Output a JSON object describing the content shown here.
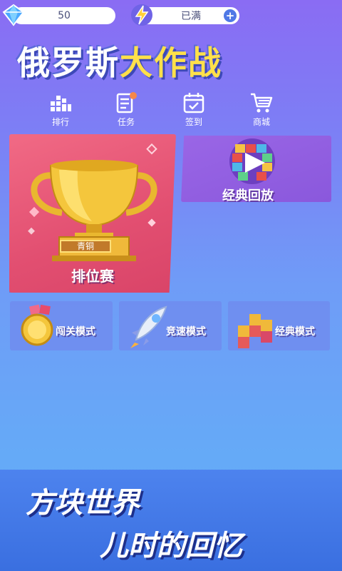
{
  "resources": {
    "gems": "50",
    "energy": "已满",
    "plus": "+"
  },
  "title": {
    "part1": "俄罗斯",
    "part2": "大作战"
  },
  "nav": {
    "rank": "排行",
    "tasks": "任务",
    "signin": "签到",
    "shop": "商城"
  },
  "cards": {
    "ranked": "排位赛",
    "tier": "青铜",
    "replay": "经典回放"
  },
  "modes": {
    "level": "闯关模式",
    "speed": "竞速模式",
    "classic": "经典模式"
  },
  "banner": {
    "line1": "方块世界",
    "line2": "儿时的回忆"
  },
  "colors": {
    "accent_yellow": "#ffe04a",
    "ranked_card": "#e24f71",
    "replay_card": "#8a58dc",
    "banner": "#3a6fe0",
    "task_badge": "#f5874a"
  }
}
